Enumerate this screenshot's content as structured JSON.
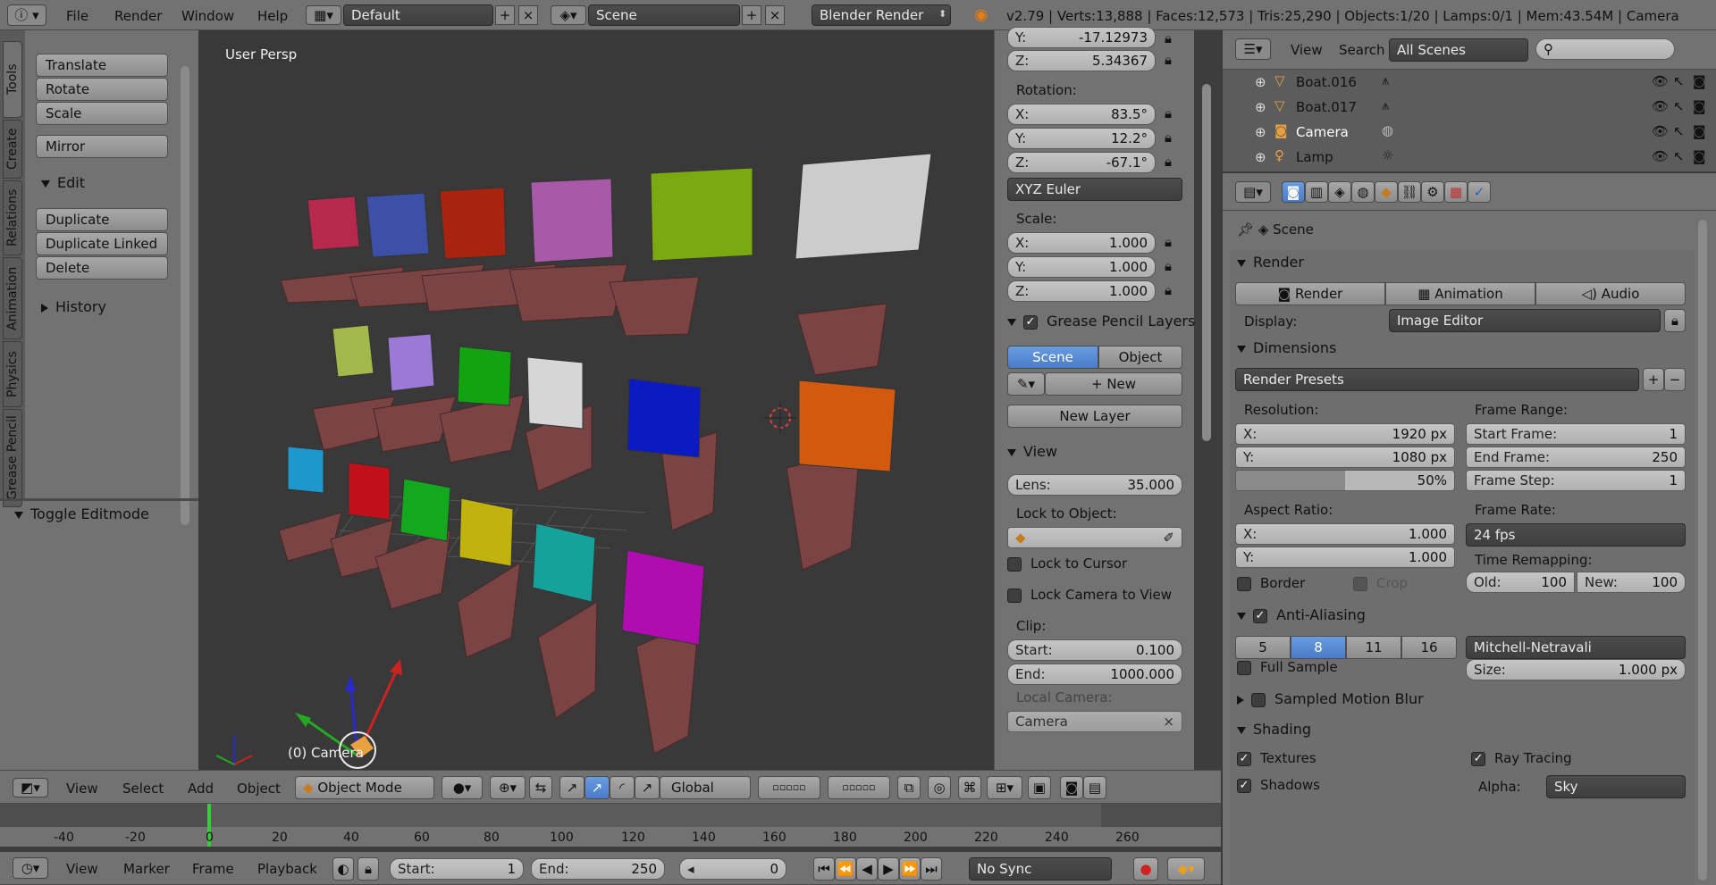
{
  "topbar": {
    "menus": [
      "File",
      "Render",
      "Window",
      "Help"
    ],
    "layout": "Default",
    "scene": "Scene",
    "engine": "Blender Render",
    "stats": "v2.79 | Verts:13,888 | Faces:12,573 | Tris:25,290 | Objects:1/20 | Lamps:0/1 | Mem:43.54M | Camera"
  },
  "toolshelf": {
    "tabs": [
      "Tools",
      "Create",
      "Relations",
      "Animation",
      "Physics",
      "Grease Pencil"
    ],
    "transform_buttons": [
      "Translate",
      "Rotate",
      "Scale"
    ],
    "mirror": "Mirror",
    "edit_header": "Edit",
    "edit_buttons": [
      "Duplicate",
      "Duplicate Linked",
      "Delete"
    ],
    "history_header": "History",
    "toggle_editmode": "Toggle Editmode"
  },
  "viewport": {
    "label": "User Persp",
    "object_label": "(0) Camera",
    "menus": [
      "View",
      "Select",
      "Add",
      "Object"
    ],
    "mode": "Object Mode",
    "orientation": "Global"
  },
  "n_panel": {
    "loc_y_label": "Y:",
    "loc_y": "-17.12973",
    "loc_z_label": "Z:",
    "loc_z": "5.34367",
    "rotation_label": "Rotation:",
    "rot": [
      {
        "l": "X:",
        "v": "83.5°"
      },
      {
        "l": "Y:",
        "v": "12.2°"
      },
      {
        "l": "Z:",
        "v": "-67.1°"
      }
    ],
    "rotation_mode": "XYZ Euler",
    "scale_label": "Scale:",
    "scale": [
      {
        "l": "X:",
        "v": "1.000"
      },
      {
        "l": "Y:",
        "v": "1.000"
      },
      {
        "l": "Z:",
        "v": "1.000"
      }
    ],
    "gp_header": "Grease Pencil Layers",
    "gp_scene": "Scene",
    "gp_object": "Object",
    "gp_new": "New",
    "gp_new_layer": "New Layer",
    "view_header": "View",
    "lens_label": "Lens:",
    "lens": "35.000",
    "lock_to_object": "Lock to Object:",
    "lock_to_cursor": "Lock to Cursor",
    "lock_camera": "Lock Camera to View",
    "clip_label": "Clip:",
    "clip_start_label": "Start:",
    "clip_start": "0.100",
    "clip_end_label": "End:",
    "clip_end": "1000.000",
    "local_camera_label": "Local Camera:",
    "local_camera": "Camera"
  },
  "outliner": {
    "menus": [
      "View",
      "Search"
    ],
    "filter": "All Scenes",
    "items": [
      "Boat.016",
      "Boat.017",
      "Camera",
      "Lamp"
    ]
  },
  "properties": {
    "context": "Scene",
    "render_header": "Render",
    "render_btn": "Render",
    "animation_btn": "Animation",
    "audio_btn": "Audio",
    "display_label": "Display:",
    "display": "Image Editor",
    "dimensions_header": "Dimensions",
    "render_presets": "Render Presets",
    "resolution_label": "Resolution:",
    "res_x_label": "X:",
    "res_x": "1920 px",
    "res_y_label": "Y:",
    "res_y": "1080 px",
    "res_pct": "50%",
    "res_pct_value": 0.5,
    "frame_range_label": "Frame Range:",
    "start_frame_label": "Start Frame:",
    "start_frame": "1",
    "end_frame_label": "End Frame:",
    "end_frame": "250",
    "frame_step_label": "Frame Step:",
    "frame_step": "1",
    "aspect_label": "Aspect Ratio:",
    "aspect_x_label": "X:",
    "aspect_x": "1.000",
    "aspect_y_label": "Y:",
    "aspect_y": "1.000",
    "frame_rate_label": "Frame Rate:",
    "frame_rate": "24 fps",
    "time_remap_label": "Time Remapping:",
    "old_label": "Old:",
    "old": "100",
    "new_label": "New:",
    "new": "100",
    "border": "Border",
    "crop": "Crop",
    "aa_header": "Anti-Aliasing",
    "aa_samples": [
      "5",
      "8",
      "11",
      "16"
    ],
    "aa_filter": "Mitchell-Netravali",
    "full_sample": "Full Sample",
    "size_label": "Size:",
    "size": "1.000 px",
    "motion_blur_header": "Sampled Motion Blur",
    "shading_header": "Shading",
    "textures": "Textures",
    "ray_tracing": "Ray Tracing",
    "shadows": "Shadows",
    "alpha_label": "Alpha:",
    "alpha": "Sky"
  },
  "timeline": {
    "ticks": [
      "-40",
      "-20",
      "0",
      "20",
      "40",
      "60",
      "80",
      "100",
      "120",
      "140",
      "160",
      "180",
      "200",
      "220",
      "240",
      "260"
    ],
    "menus": [
      "View",
      "Marker",
      "Frame",
      "Playback"
    ],
    "start_label": "Start:",
    "start": "1",
    "end_label": "End:",
    "end": "250",
    "current": "0",
    "sync": "No Sync"
  },
  "colors": {
    "accent": "#5680c2",
    "viewport": "#393939",
    "panel": "#727272"
  }
}
